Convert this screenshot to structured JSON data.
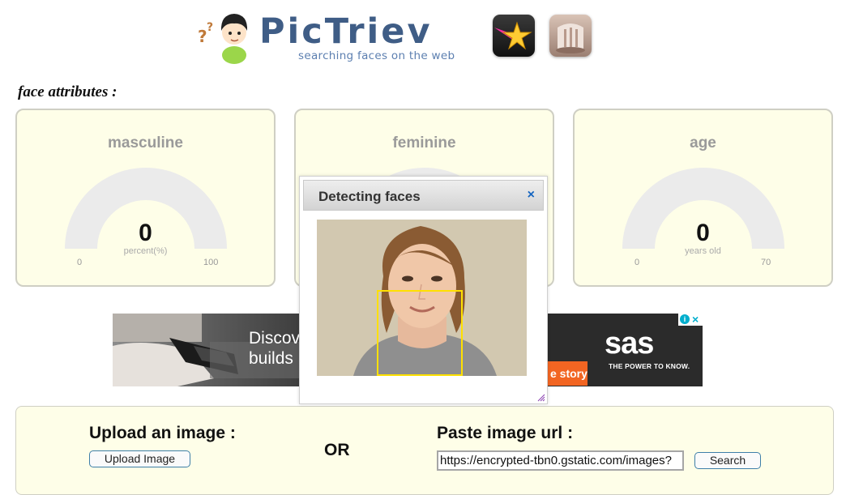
{
  "header": {
    "brand_name": "PicTriev",
    "tagline": "searching faces on the web"
  },
  "attributes": {
    "section_label": "face attributes :",
    "masculine": {
      "title": "masculine",
      "value": "0",
      "unit": "percent(%)",
      "min": "0",
      "max": "100",
      "level": 0
    },
    "feminine": {
      "title": "feminine"
    },
    "age": {
      "title": "age",
      "value": "0",
      "unit": "years old",
      "min": "0",
      "max": "70",
      "level": 0
    }
  },
  "ad": {
    "line1": "Discov",
    "line2": "builds",
    "cta": "e story",
    "brand": "sas",
    "brand_tagline": "THE POWER TO KNOW."
  },
  "dialog": {
    "title": "Detecting faces",
    "close": "×"
  },
  "search": {
    "upload_heading": "Upload an image :",
    "upload_button": "Upload Image",
    "or_label": "OR",
    "url_heading": "Paste image url :",
    "url_value": "https://encrypted-tbn0.gstatic.com/images?",
    "search_button": "Search"
  },
  "colors": {
    "brand_blue": "#3f5d86",
    "panel_background": "#fefee8",
    "gauge_track": "#ebebeb",
    "face_box": "#ffe000",
    "sas_orange": "#f26522",
    "close_blue": "#1565c0"
  }
}
